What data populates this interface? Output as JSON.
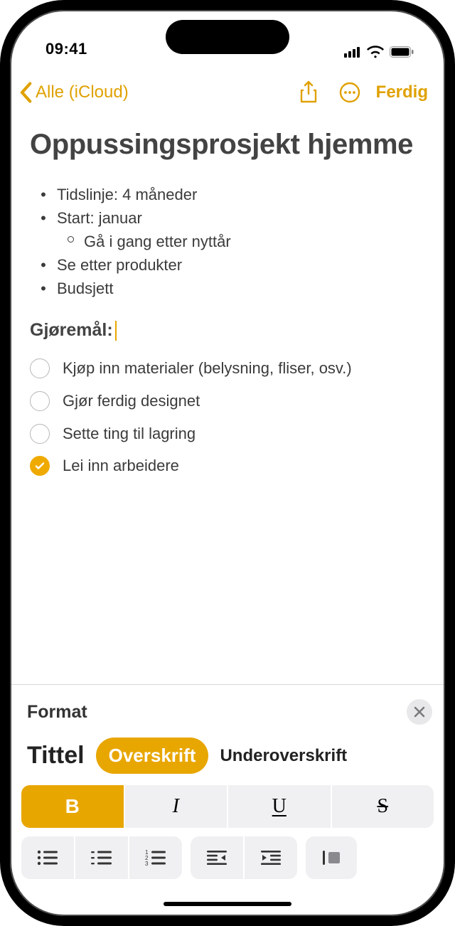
{
  "status": {
    "time": "09:41"
  },
  "nav": {
    "back_label": "Alle (iCloud)",
    "done_label": "Ferdig"
  },
  "note": {
    "title": "Oppussingsprosjekt hjemme",
    "bullets": [
      {
        "text": "Tidslinje: 4 måneder",
        "indent": 0
      },
      {
        "text": "Start: januar",
        "indent": 0
      },
      {
        "text": "Gå i gang etter nyttår",
        "indent": 1
      },
      {
        "text": "Se etter produkter",
        "indent": 0
      },
      {
        "text": "Budsjett",
        "indent": 0
      }
    ],
    "heading": "Gjøremål:",
    "checklist": [
      {
        "text": "Kjøp inn materialer (belysning, fliser, osv.)",
        "checked": false
      },
      {
        "text": "Gjør ferdig designet",
        "checked": false
      },
      {
        "text": "Sette ting til lagring",
        "checked": false
      },
      {
        "text": "Lei inn arbeidere",
        "checked": true
      }
    ]
  },
  "format": {
    "panel_title": "Format",
    "styles": {
      "title": "Tittel",
      "heading": "Overskrift",
      "subheading": "Underoverskrift",
      "active": "heading"
    },
    "biu": {
      "bold": "B",
      "italic": "I",
      "underline": "U",
      "strike": "S",
      "active": "bold"
    }
  }
}
